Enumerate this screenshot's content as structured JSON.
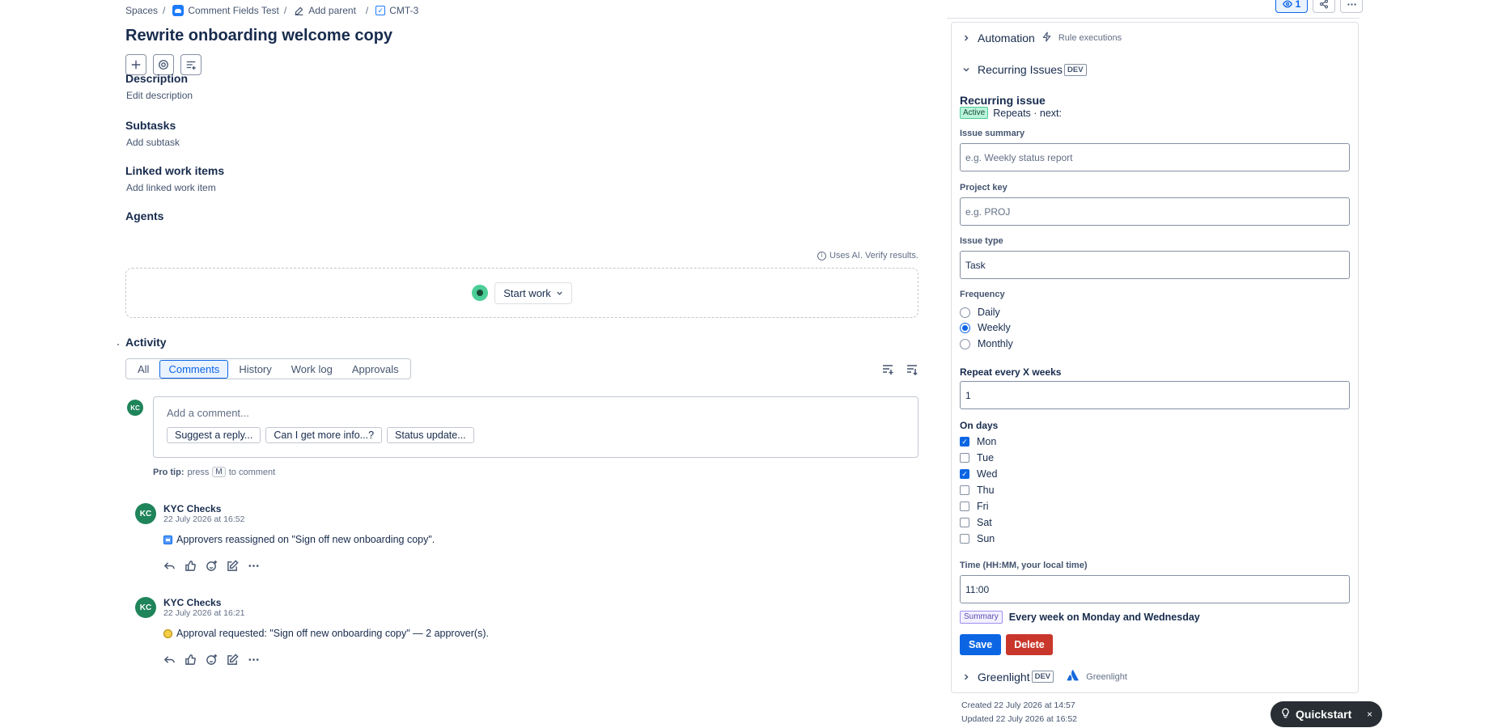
{
  "breadcrumb": {
    "spaces": "Spaces",
    "project": "Comment Fields Test",
    "add_parent": "Add parent",
    "issue_key": "CMT-3",
    "separator": "/"
  },
  "issue": {
    "title": "Rewrite onboarding welcome copy"
  },
  "sections": {
    "description": {
      "heading": "Description",
      "link": "Edit description"
    },
    "subtasks": {
      "heading": "Subtasks",
      "link": "Add subtask"
    },
    "linked": {
      "heading": "Linked work items",
      "link": "Add linked work item"
    },
    "agents": {
      "heading": "Agents",
      "ai_note": "Uses AI. Verify results.",
      "start_work": "Start work"
    }
  },
  "activity": {
    "heading": "Activity",
    "tabs": [
      {
        "label": "All"
      },
      {
        "label": "Comments",
        "active": true
      },
      {
        "label": "History"
      },
      {
        "label": "Work log"
      },
      {
        "label": "Approvals"
      }
    ],
    "composer": {
      "avatar": "KC",
      "placeholder": "Add a comment...",
      "suggestions": [
        "Suggest a reply...",
        "Can I get more info...?",
        "Status update..."
      ]
    },
    "pro_tip": {
      "label": "Pro tip:",
      "press": "press",
      "key": "M",
      "suffix": "to comment"
    },
    "comments": [
      {
        "avatar": "KC",
        "author": "KYC Checks",
        "time": "22 July 2026 at 16:52",
        "body": "Approvers reassigned on \"Sign off new onboarding copy\".",
        "icon": "approver-icon"
      },
      {
        "avatar": "KC",
        "author": "KYC Checks",
        "time": "22 July 2026 at 16:21",
        "body": "Approval requested: \"Sign off new onboarding copy\" — 2 approver(s).",
        "icon": "approval-request-icon"
      }
    ]
  },
  "top_actions": {
    "watch_count": "1"
  },
  "panel": {
    "automation": {
      "title": "Automation",
      "sub": "Rule executions"
    },
    "recurring": {
      "title": "Recurring Issues",
      "tag": "DEV",
      "heading": "Recurring issue",
      "status": "Active",
      "status_text": "Repeats · next:",
      "fields": {
        "summary": {
          "label": "Issue summary",
          "placeholder": "e.g. Weekly status report"
        },
        "project_key": {
          "label": "Project key",
          "placeholder": "e.g. PROJ"
        },
        "issue_type": {
          "label": "Issue type",
          "value": "Task"
        }
      },
      "frequency": {
        "label": "Frequency",
        "options": [
          {
            "label": "Daily",
            "selected": false
          },
          {
            "label": "Weekly",
            "selected": true
          },
          {
            "label": "Monthly",
            "selected": false
          }
        ]
      },
      "repeat_every": {
        "label": "Repeat every X weeks",
        "value": "1"
      },
      "on_days": {
        "label": "On days",
        "days": [
          {
            "label": "Mon",
            "checked": true
          },
          {
            "label": "Tue",
            "checked": false
          },
          {
            "label": "Wed",
            "checked": true
          },
          {
            "label": "Thu",
            "checked": false
          },
          {
            "label": "Fri",
            "checked": false
          },
          {
            "label": "Sat",
            "checked": false
          },
          {
            "label": "Sun",
            "checked": false
          }
        ]
      },
      "time": {
        "label": "Time (HH:MM, your local time)",
        "value": "11:00"
      },
      "summary": {
        "tag": "Summary",
        "text": "Every week on Monday and Wednesday"
      },
      "save": "Save",
      "delete": "Delete"
    },
    "greenlight": {
      "title": "Greenlight",
      "tag": "DEV",
      "sub": "Greenlight"
    }
  },
  "meta": {
    "created": "Created 22 July 2026 at 14:57",
    "updated": "Updated 22 July 2026 at 16:52"
  },
  "quickstart": {
    "label": "Quickstart",
    "close": "×"
  }
}
